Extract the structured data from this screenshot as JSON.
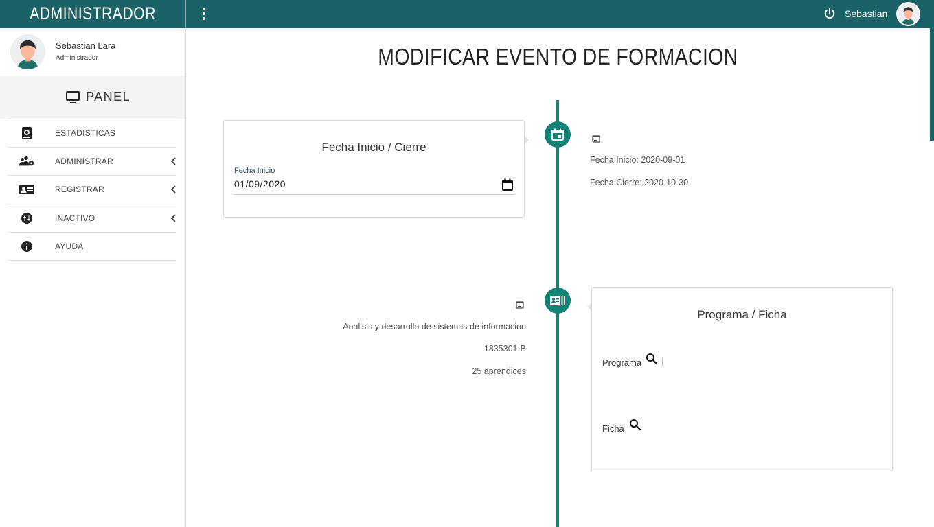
{
  "header": {
    "brand": "ADMINISTRADOR",
    "user_name": "Sebastian",
    "menu_icon": "more-vertical-icon",
    "power_icon": "power-icon"
  },
  "sidebar": {
    "profile": {
      "name": "Sebastian Lara",
      "role": "Administrador"
    },
    "panel_label": "PANEL",
    "items": [
      {
        "label": "ESTADISTICAS",
        "icon": "book-globe-icon",
        "has_submenu": false
      },
      {
        "label": "ADMINISTRAR",
        "icon": "users-gear-icon",
        "has_submenu": true
      },
      {
        "label": "REGISTRAR",
        "icon": "id-card-icon",
        "has_submenu": true
      },
      {
        "label": "INACTIVO",
        "icon": "sort-circle-icon",
        "has_submenu": true
      },
      {
        "label": "AYUDA",
        "icon": "info-icon",
        "has_submenu": false
      }
    ]
  },
  "main": {
    "title": "MODIFICAR EVENTO DE FORMACION",
    "event1": {
      "card_title": "Fecha Inicio / Cierre",
      "field_label": "Fecha Inicio",
      "field_value": "01/09/2020",
      "summary_start": "Fecha Inicio: 2020-09-01",
      "summary_end": "Fecha Cierre: 2020-10-30"
    },
    "event2": {
      "card_title": "Programa / Ficha",
      "program_label": "Programa",
      "ficha_label": "Ficha",
      "summary_program": "Analisis y desarrollo de sistemas de informacion",
      "summary_ficha": "1835301-B",
      "summary_learners": "25 aprendices"
    }
  },
  "colors": {
    "header_bg": "#1b6266",
    "timeline": "#128276",
    "sidebar_panel_bg": "#f4f4f4"
  }
}
